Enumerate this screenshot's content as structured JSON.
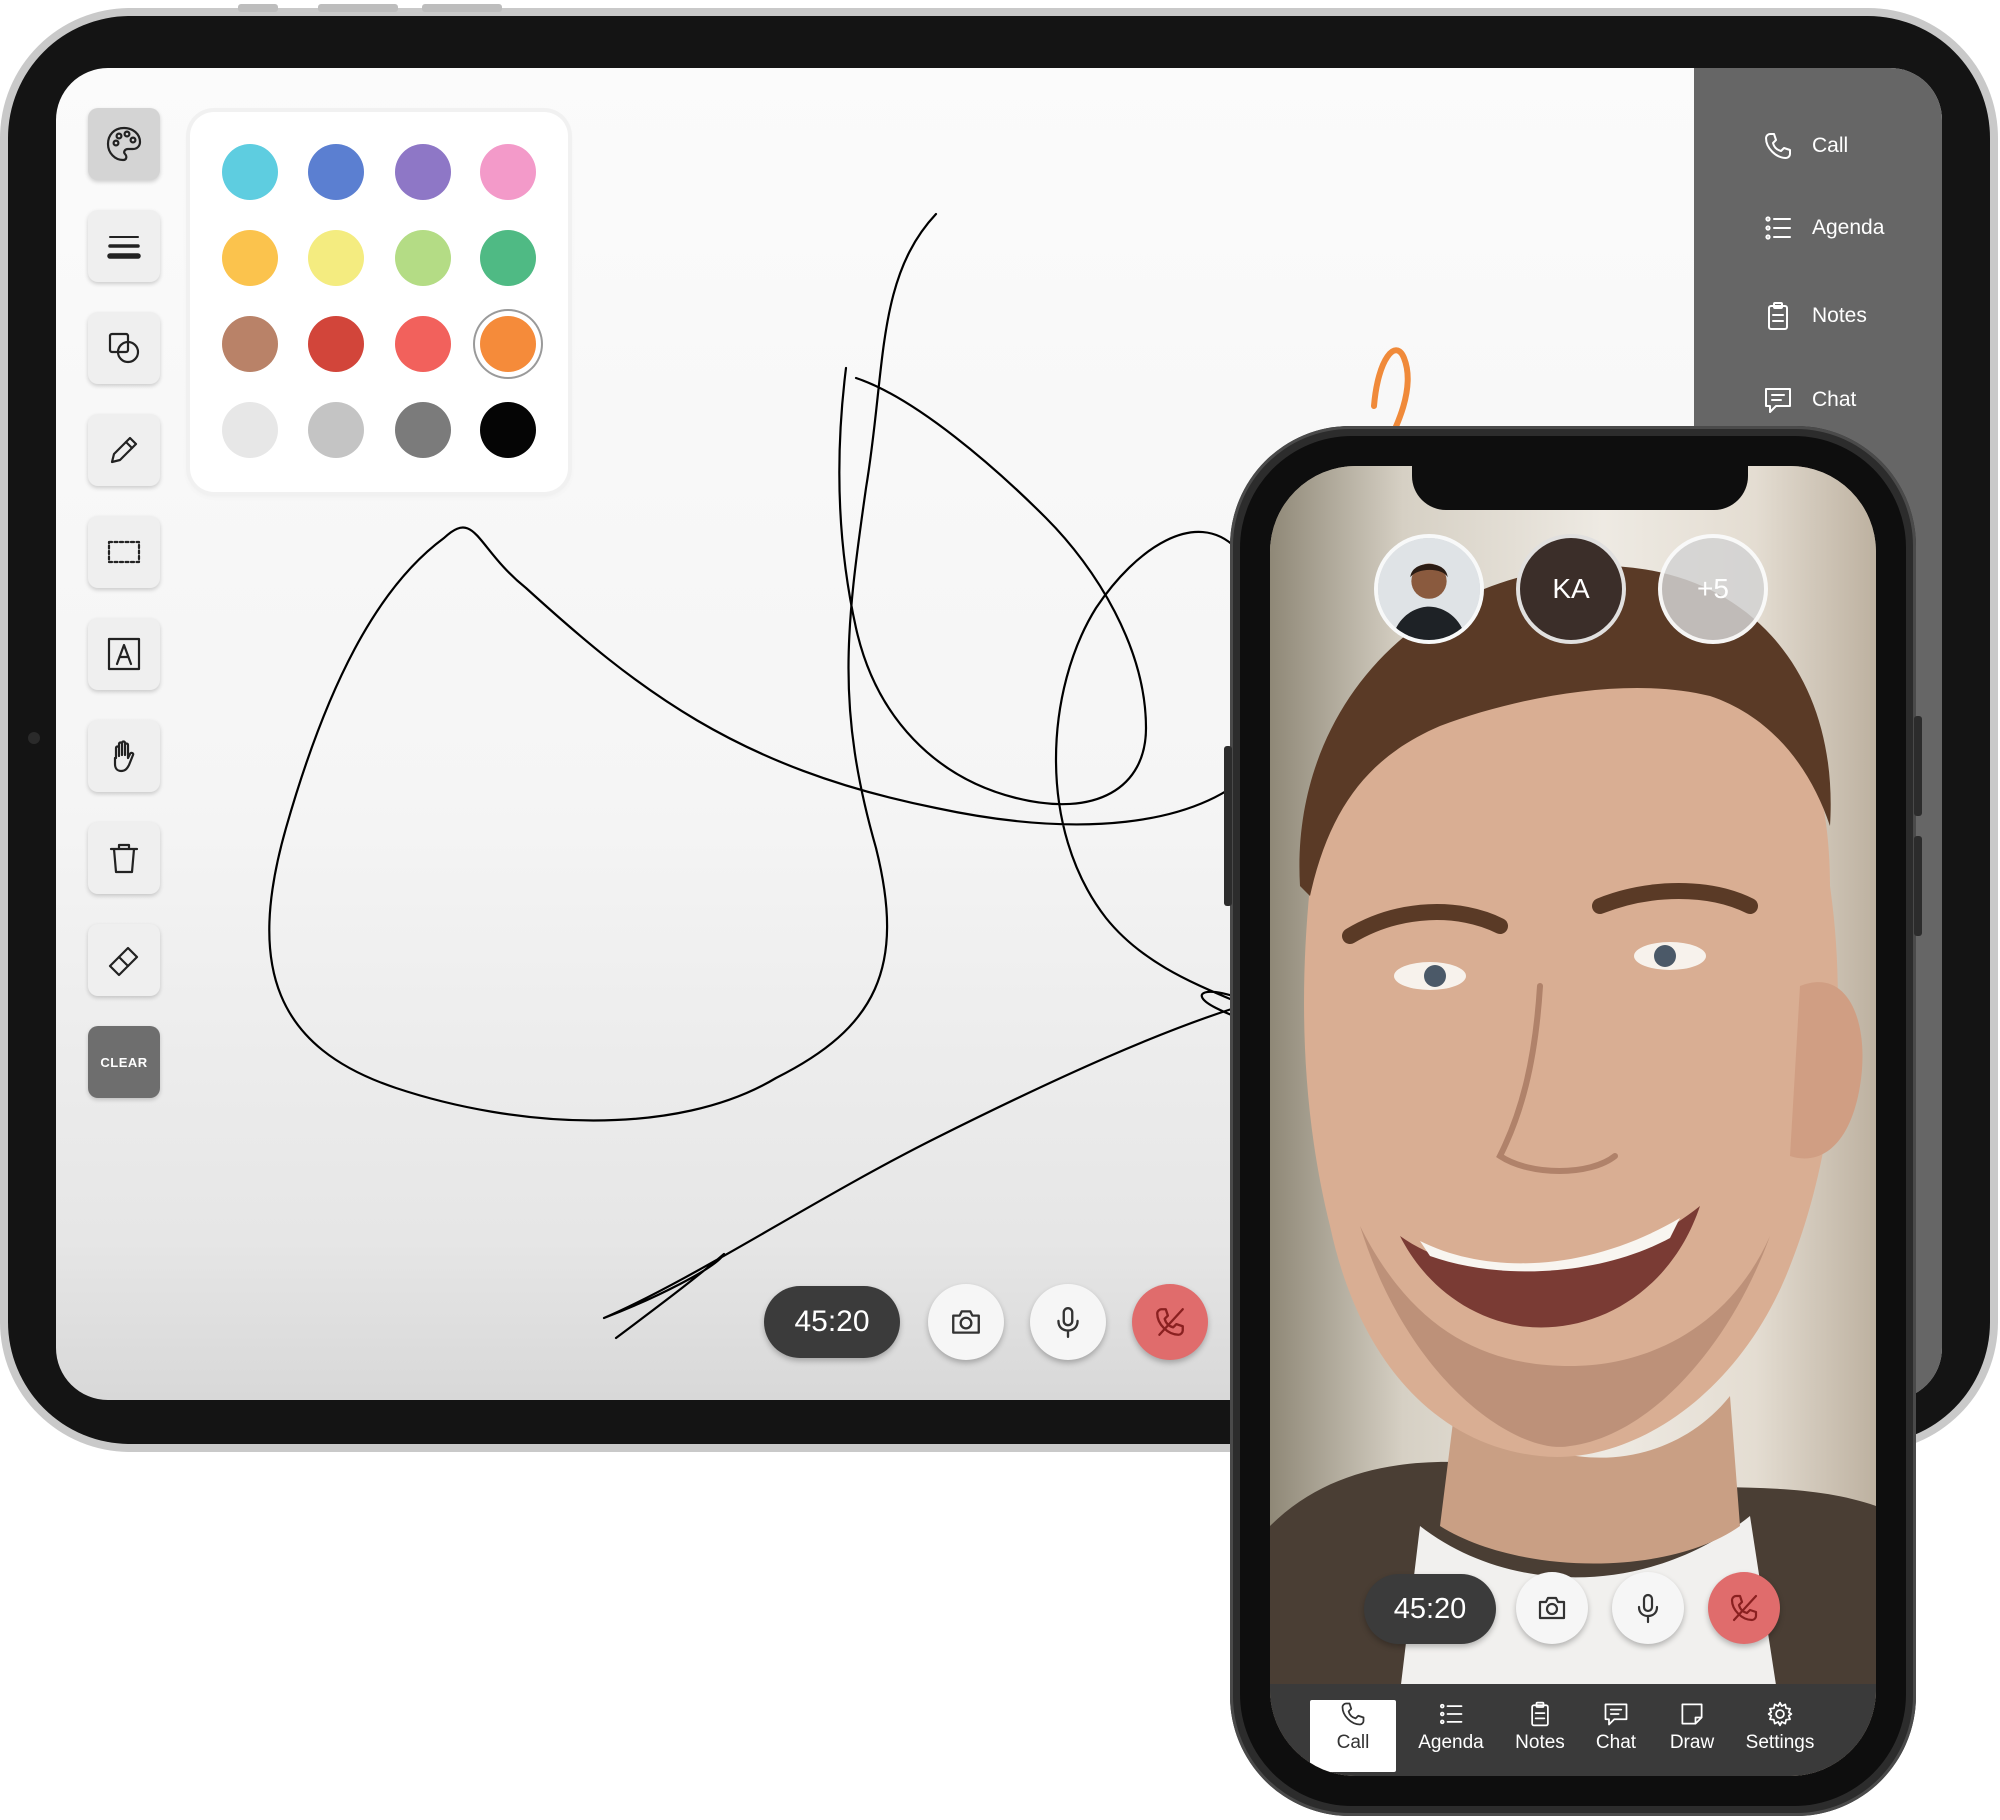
{
  "tablet": {
    "toolbar": {
      "tools": [
        {
          "name": "palette-tool",
          "icon": "palette-icon",
          "active": true
        },
        {
          "name": "stroke-width-tool",
          "icon": "lines-icon"
        },
        {
          "name": "shapes-tool",
          "icon": "shapes-icon"
        },
        {
          "name": "pencil-tool",
          "icon": "pencil-icon"
        },
        {
          "name": "select-tool",
          "icon": "selection-icon"
        },
        {
          "name": "text-tool",
          "icon": "text-icon"
        },
        {
          "name": "pan-tool",
          "icon": "hand-icon"
        },
        {
          "name": "delete-tool",
          "icon": "trash-icon"
        },
        {
          "name": "eraser-tool",
          "icon": "eraser-icon"
        }
      ],
      "clear_label": "CLEAR"
    },
    "palette": {
      "colors": [
        "#5ecde0",
        "#5b7fd1",
        "#8e77c6",
        "#f39ac9",
        "#fbc34d",
        "#f4ec80",
        "#b4dc85",
        "#4fba84",
        "#b98268",
        "#d2453a",
        "#f2615c",
        "#f58b3a",
        "#e7e7e7",
        "#c4c4c4",
        "#7b7b7b",
        "#050505"
      ],
      "selected": "#f58b3a"
    },
    "sidenav": [
      {
        "label": "Call",
        "icon": "phone-icon"
      },
      {
        "label": "Agenda",
        "icon": "list-icon"
      },
      {
        "label": "Notes",
        "icon": "clipboard-icon"
      },
      {
        "label": "Chat",
        "icon": "chat-icon"
      }
    ],
    "controls": {
      "timer": "45:20",
      "camera_icon": "camera-icon",
      "mic_icon": "microphone-icon",
      "end_icon": "end-call-icon"
    }
  },
  "phone": {
    "participants": [
      {
        "type": "avatar",
        "icon": "person-avatar"
      },
      {
        "type": "initials",
        "label": "KA"
      },
      {
        "type": "more",
        "label": "+5"
      }
    ],
    "controls": {
      "timer": "45:20"
    },
    "tabs": [
      {
        "label": "Call",
        "icon": "phone-icon",
        "active": true
      },
      {
        "label": "Agenda",
        "icon": "list-icon"
      },
      {
        "label": "Notes",
        "icon": "clipboard-icon"
      },
      {
        "label": "Chat",
        "icon": "chat-icon"
      },
      {
        "label": "Draw",
        "icon": "draw-icon"
      },
      {
        "label": "Settings",
        "icon": "gear-icon"
      }
    ]
  },
  "colors": {
    "end_call": "#e06c6c",
    "sidenav_bg": "#666666",
    "timer_bg": "#3b3b3b"
  }
}
